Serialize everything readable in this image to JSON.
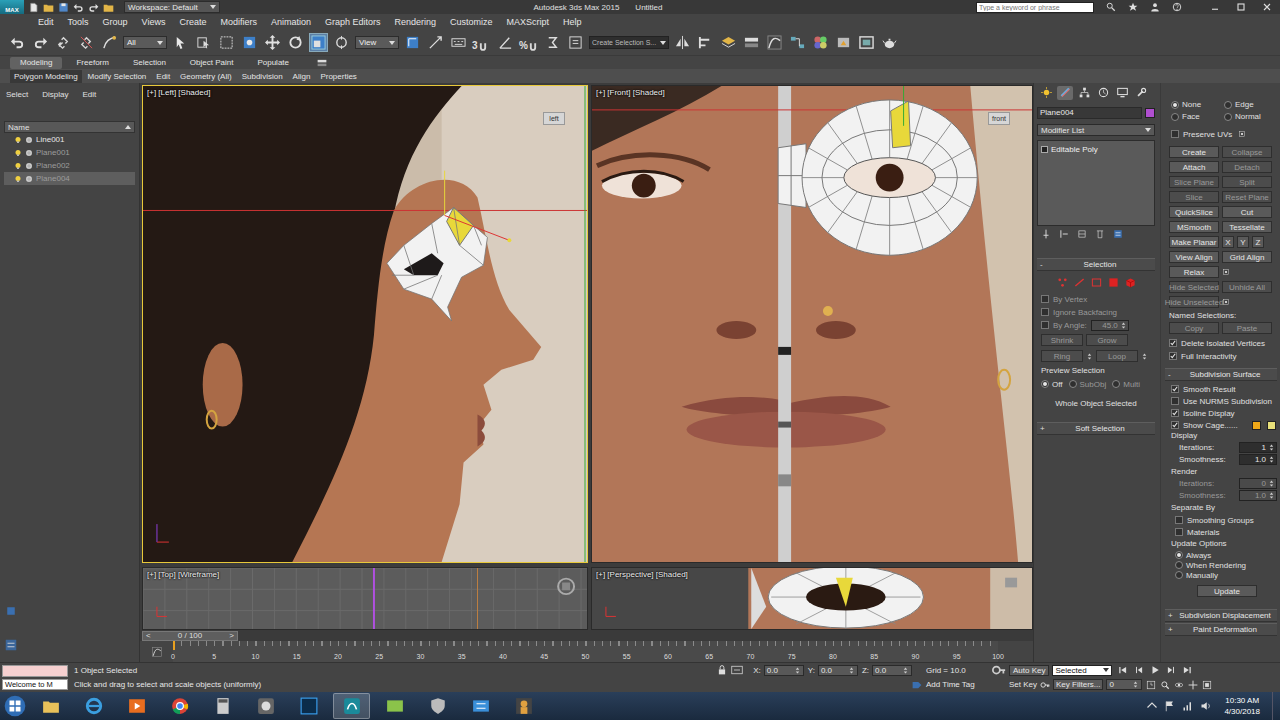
{
  "titlebar": {
    "logo": "MAX",
    "workspace": "Workspace: Default",
    "app": "Autodesk 3ds Max 2015",
    "document": "Untitled",
    "search_placeholder": "Type a keyword or phrase"
  },
  "menu": [
    "Edit",
    "Tools",
    "Group",
    "Views",
    "Create",
    "Modifiers",
    "Animation",
    "Graph Editors",
    "Rendering",
    "Customize",
    "MAXScript",
    "Help"
  ],
  "toolbar": {
    "filter": "All",
    "coord": "View",
    "snap_labels": [
      "3",
      "%"
    ],
    "selection_set": "Create Selection S..."
  },
  "ribbon": {
    "tabs": [
      {
        "label": "Modeling",
        "selected": true
      },
      {
        "label": "Freeform",
        "selected": false
      },
      {
        "label": "Selection",
        "selected": false
      },
      {
        "label": "Object Paint",
        "selected": false
      },
      {
        "label": "Populate",
        "selected": false
      }
    ],
    "panels": [
      {
        "label": "Polygon Modeling",
        "selected": true
      },
      {
        "label": "Modify Selection",
        "selected": false
      },
      {
        "label": "Edit",
        "selected": false
      },
      {
        "label": "Geometry (All)",
        "selected": false
      },
      {
        "label": "Subdivision",
        "selected": false
      },
      {
        "label": "Align",
        "selected": false
      },
      {
        "label": "Properties",
        "selected": false
      }
    ]
  },
  "explorer": {
    "tabs": [
      "Select",
      "Display",
      "Edit"
    ],
    "column": "Name",
    "items": [
      {
        "name": "Line001",
        "selected": false,
        "dimmed": false
      },
      {
        "name": "Plane001",
        "selected": false,
        "dimmed": true
      },
      {
        "name": "Plane002",
        "selected": false,
        "dimmed": true
      },
      {
        "name": "Plane004",
        "selected": true,
        "dimmed": true
      }
    ]
  },
  "viewports": [
    {
      "label": "[+] [Left] [Shaded]",
      "cube": "left",
      "active": true,
      "kind": "left"
    },
    {
      "label": "[+] [Front] [Shaded]",
      "cube": "front",
      "active": false,
      "kind": "front"
    },
    {
      "label": "[+] [Top] [Wireframe]",
      "active": false,
      "kind": "top"
    },
    {
      "label": "[+] [Perspective] [Shaded]",
      "active": false,
      "kind": "persp"
    }
  ],
  "command_panel": {
    "tabs": [
      {
        "selected": false
      },
      {
        "selected": true
      },
      {
        "selected": false
      },
      {
        "selected": false
      },
      {
        "selected": false
      },
      {
        "selected": false
      }
    ],
    "object_name": "Plane004",
    "object_color": "#b04fd0",
    "modifier_list": "Modifier List",
    "stack": [
      {
        "label": "Editable Poly",
        "selected": false
      }
    ],
    "selection": {
      "sign": "-",
      "title": "Selection",
      "levels": [
        {
          "selected": false
        },
        {
          "selected": false
        },
        {
          "selected": false
        },
        {
          "selected": false
        },
        {
          "selected": false
        }
      ],
      "checks": [
        {
          "label": "By Vertex",
          "checked": false,
          "disabled": true
        },
        {
          "label": "Ignore Backfacing",
          "checked": false,
          "disabled": true
        },
        {
          "label": "By Angle:",
          "checked": false,
          "disabled": true
        }
      ],
      "angle": "45.0",
      "buttons": [
        {
          "label": "Shrink",
          "disabled": true
        },
        {
          "label": "Grow",
          "disabled": true
        },
        {
          "label": "Ring",
          "disabled": true
        },
        {
          "label": "Loop",
          "disabled": true
        }
      ],
      "preview_title": "Preview Selection",
      "preview": [
        {
          "label": "Off",
          "selected": true,
          "disabled": false
        },
        {
          "label": "SubObj",
          "selected": false,
          "disabled": true
        },
        {
          "label": "Multi",
          "selected": false,
          "disabled": true
        }
      ],
      "status": "Whole Object Selected"
    },
    "soft_selection": {
      "sign": "+",
      "title": "Soft Selection"
    },
    "constraints": [
      {
        "label": "None",
        "selected": true
      },
      {
        "label": "Edge",
        "selected": false
      },
      {
        "label": "Face",
        "selected": false
      },
      {
        "label": "Normal",
        "selected": false
      }
    ],
    "preserve_uvs": {
      "label": "Preserve UVs",
      "checked": false
    },
    "button_rows": [
      [
        {
          "label": "Create",
          "disabled": false
        },
        {
          "label": "Collapse",
          "disabled": true
        }
      ],
      [
        {
          "label": "Attach",
          "disabled": false
        },
        {
          "label": "Detach",
          "disabled": true
        }
      ],
      [
        {
          "label": "Slice Plane",
          "disabled": true
        },
        {
          "label": "Split",
          "disabled": true
        }
      ],
      [
        {
          "label": "Slice",
          "disabled": true
        },
        {
          "label": "Reset Plane",
          "disabled": true
        }
      ],
      [
        {
          "label": "QuickSlice",
          "disabled": false
        },
        {
          "label": "Cut",
          "disabled": false
        }
      ],
      [
        {
          "label": "MSmooth",
          "disabled": false
        },
        {
          "label": "Tessellate",
          "disabled": false
        }
      ],
      [
        {
          "label": "Make Planar",
          "disabled": false
        },
        {
          "label": "X",
          "disabled": false
        },
        {
          "label": "Y",
          "disabled": false
        },
        {
          "label": "Z",
          "disabled": false
        }
      ],
      [
        {
          "label": "View Align",
          "disabled": false
        },
        {
          "label": "Grid Align",
          "disabled": false
        }
      ],
      [
        {
          "label": "Relax",
          "disabled": false
        }
      ],
      [
        {
          "label": "Hide Selected",
          "disabled": true
        },
        {
          "label": "Unhide All",
          "disabled": true
        }
      ],
      [
        {
          "label": "Hide Unselected",
          "disabled": true
        }
      ]
    ],
    "named_selections": "Named Selections:",
    "named_buttons": [
      {
        "label": "Copy",
        "disabled": true
      },
      {
        "label": "Paste",
        "disabled": true
      }
    ],
    "edit_checks": [
      {
        "label": "Delete Isolated Vertices",
        "checked": true
      },
      {
        "label": "Full Interactivity",
        "checked": true
      }
    ],
    "subdivision": {
      "sign": "-",
      "title": "Subdivision Surface",
      "checks": [
        {
          "label": "Smooth Result",
          "checked": true
        },
        {
          "label": "Use NURMS Subdivision",
          "checked": false
        },
        {
          "label": "Isoline Display",
          "checked": true
        },
        {
          "label": "Show Cage......",
          "checked": true
        }
      ],
      "cage_colors": [
        "#f0a818",
        "#e8e07a"
      ],
      "display_title": "Display",
      "display": [
        {
          "label": "Iterations:",
          "value": "1",
          "disabled": false
        },
        {
          "label": "Smoothness:",
          "value": "1.0",
          "disabled": false
        }
      ],
      "render_title": "Render",
      "render": [
        {
          "label": "Iterations:",
          "value": "0",
          "disabled": true
        },
        {
          "label": "Smoothness:",
          "value": "1.0",
          "disabled": true
        }
      ],
      "separate_title": "Separate By",
      "separate": [
        {
          "label": "Smoothing Groups",
          "checked": false
        },
        {
          "label": "Materials",
          "checked": false
        }
      ],
      "update_title": "Update Options",
      "update": [
        {
          "label": "Always",
          "selected": true
        },
        {
          "label": "When Rendering",
          "selected": false
        },
        {
          "label": "Manually",
          "selected": false
        }
      ],
      "update_button": "Update"
    },
    "collapsed": [
      {
        "sign": "+",
        "title": "Subdivision Displacement"
      },
      {
        "sign": "+",
        "title": "Paint Deformation"
      }
    ]
  },
  "timeline": {
    "prev": "<",
    "frame": "0 / 100",
    "next": ">",
    "level": 0,
    "ticks": [
      "0",
      "5",
      "10",
      "15",
      "20",
      "25",
      "30",
      "35",
      "40",
      "45",
      "50",
      "55",
      "60",
      "65",
      "70",
      "75",
      "80",
      "85",
      "90",
      "95",
      "100"
    ]
  },
  "status": {
    "listener": "Welcome to M",
    "selected": "1 Object Selected",
    "prompt": "Click and drag to select and scale objects (uniformly)",
    "x_label": "X:",
    "x": "0.0",
    "y_label": "Y:",
    "y": "0.0",
    "z_label": "Z:",
    "z": "0.0",
    "grid": "Grid = 10.0",
    "time_tag": "Add Time Tag",
    "auto_key": "Auto Key",
    "key_mode": "Selected",
    "set_key": "Set Key",
    "key_filters": "Key Filters...",
    "frame": "0"
  },
  "taskbar": {
    "time": "10:30 AM",
    "date": "4/30/2018"
  }
}
